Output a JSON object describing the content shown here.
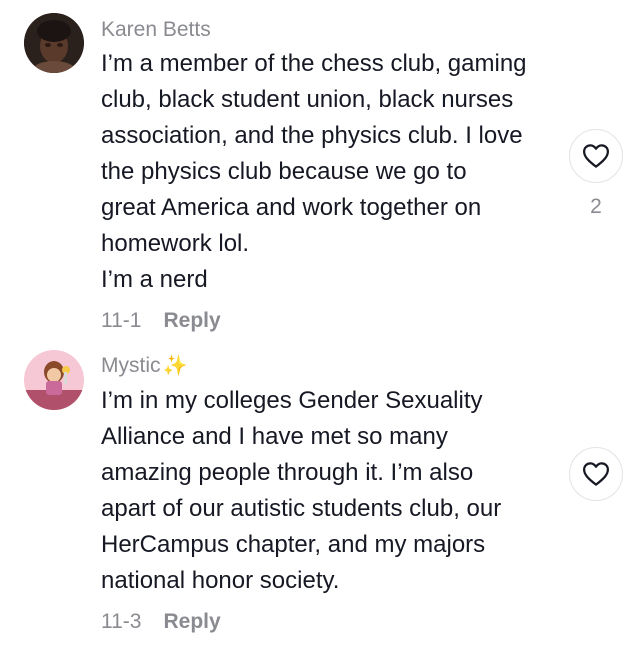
{
  "comments": [
    {
      "username": "Karen Betts",
      "username_suffix": "",
      "lines": [
        "I’m a member of the chess club, gaming",
        "club, black student union, black nurses",
        "association, and the physics club. I love",
        "the physics club because we go to",
        "great America and work together on",
        "homework lol.",
        "I’m a nerd"
      ],
      "date": "11-1",
      "reply_label": "Reply",
      "like_count": "2",
      "like_icon": "heart-outline-icon"
    },
    {
      "username": "Mystic",
      "username_suffix": "✨",
      "lines": [
        "I’m in my colleges Gender Sexuality",
        "Alliance and I have met so many",
        "amazing people through it. I’m also",
        "apart of our autistic students club, our",
        "HerCampus chapter, and my majors",
        "national honor society."
      ],
      "date": "11-3",
      "reply_label": "Reply",
      "like_count": "",
      "like_icon": "heart-outline-icon"
    }
  ],
  "colors": {
    "text": "#161823",
    "secondary": "#8a8b91",
    "sparkle": "#f7c948"
  }
}
